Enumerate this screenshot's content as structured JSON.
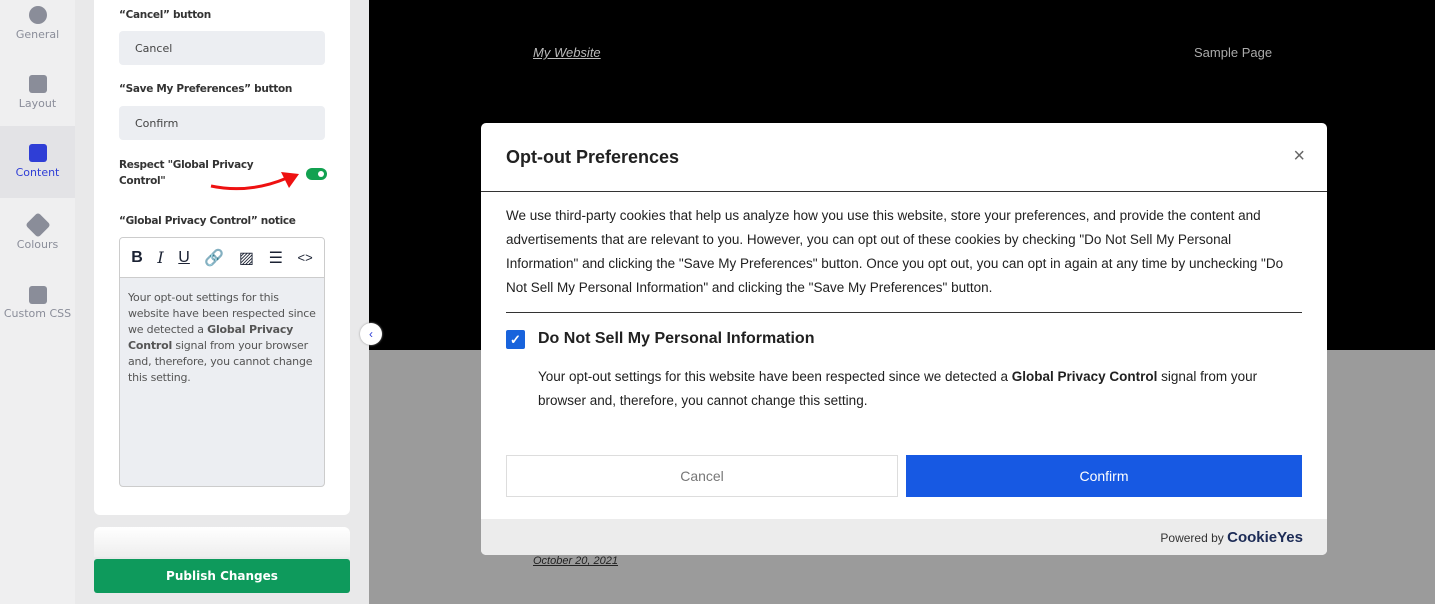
{
  "sidebar": {
    "items": [
      {
        "label": "General"
      },
      {
        "label": "Layout"
      },
      {
        "label": "Content"
      },
      {
        "label": "Colours"
      },
      {
        "label": "Custom CSS"
      }
    ]
  },
  "panel": {
    "cancel_label": "“Cancel” button",
    "cancel_value": "Cancel",
    "save_label": "“Save My Preferences” button",
    "save_value": "Confirm",
    "gpc_toggle_label": "Respect \"Global Privacy Control\"",
    "gpc_toggle_on": true,
    "gpc_notice_label": "“Global Privacy Control” notice",
    "notice_pre": "Your opt-out settings for this website have been respected since we detected a ",
    "notice_bold": "Global Privacy Control",
    "notice_post": " signal from your browser and, therefore, you cannot change this setting.",
    "publish": "Publish Changes"
  },
  "preview": {
    "site_title": "My Website",
    "nav_link": "Sample Page",
    "date": "October 20, 2021"
  },
  "modal": {
    "title": "Opt-out Preferences",
    "close": "×",
    "description": "We use third-party cookies that help us analyze how you use this website, store your preferences, and provide the content and advertisements that are relevant to you. However, you can opt out of these cookies by checking \"Do Not Sell My Personal Information\" and clicking the \"Save My Preferences\" button. Once you opt out, you can opt in again at any time by unchecking \"Do Not Sell My Personal Information\" and clicking the \"Save My Preferences\" button.",
    "checkbox_label": "Do Not Sell My Personal Information",
    "checkbox_checked": true,
    "gpc_pre": "Your opt-out settings for this website have been respected since we detected a ",
    "gpc_bold": "Global Privacy Control",
    "gpc_post": " signal from your browser and, therefore, you cannot change this setting.",
    "cancel": "Cancel",
    "confirm": "Confirm",
    "powered_by": "Powered by",
    "brand": "CookieYes"
  },
  "colors": {
    "accent": "#1759e3",
    "publish": "#0e9a5c",
    "toggle": "#12a150"
  }
}
